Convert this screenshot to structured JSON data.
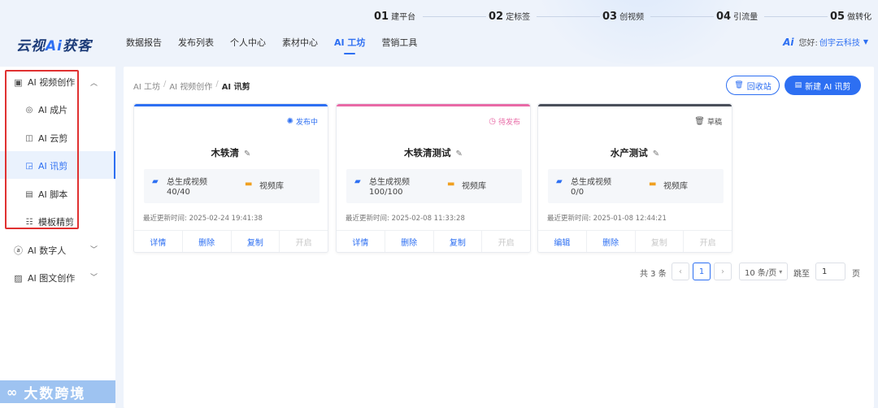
{
  "steps": [
    {
      "num": "01",
      "label": "建平台"
    },
    {
      "num": "02",
      "label": "定标签"
    },
    {
      "num": "03",
      "label": "创视频"
    },
    {
      "num": "04",
      "label": "引流量"
    },
    {
      "num": "05",
      "label": "做转化"
    }
  ],
  "logo": {
    "part1": "云视",
    "part2": "Ai",
    "part3": "获客"
  },
  "nav": [
    "数据报告",
    "发布列表",
    "个人中心",
    "素材中心",
    "AI 工坊",
    "营销工具"
  ],
  "nav_active_index": 4,
  "user": {
    "brand_icon": "Ai",
    "greeting": "您好:",
    "name": "创宇云科技"
  },
  "sidebar": {
    "group_video": "AI 视频创作",
    "items": [
      "AI 成片",
      "AI 云剪",
      "AI 讯剪",
      "AI 脚本",
      "模板精剪"
    ],
    "active_item_index": 2,
    "group_digital": "AI 数字人",
    "group_imgtext": "AI 图文创作"
  },
  "watermark": "大数跨境",
  "breadcrumb": {
    "l1": "AI 工坊",
    "l2": "AI 视频创作",
    "l3": "AI 讯剪",
    "sep": "/"
  },
  "buttons": {
    "recycle": "回收站",
    "new": "新建 AI 讯剪"
  },
  "labels": {
    "total": "总生成视频",
    "library": "视频库",
    "updated_prefix": "最近更新时间:"
  },
  "cards": [
    {
      "status": "发布中",
      "status_icon": "loading-icon",
      "status_color": "#2d6ff2",
      "bar_color": "#2d6ff2",
      "title": "木轶清",
      "count": "40/40",
      "updated": "2025-02-24 19:41:38",
      "actions": [
        {
          "label": "详情",
          "enabled": true
        },
        {
          "label": "删除",
          "enabled": true
        },
        {
          "label": "复制",
          "enabled": true
        },
        {
          "label": "开启",
          "enabled": false
        }
      ]
    },
    {
      "status": "待发布",
      "status_icon": "clock-icon",
      "status_color": "#e86aa6",
      "bar_color": "#e86aa6",
      "title": "木轶清测试",
      "count": "100/100",
      "updated": "2025-02-08 11:33:28",
      "actions": [
        {
          "label": "详情",
          "enabled": true
        },
        {
          "label": "删除",
          "enabled": true
        },
        {
          "label": "复制",
          "enabled": true
        },
        {
          "label": "开启",
          "enabled": false
        }
      ]
    },
    {
      "status": "草稿",
      "status_icon": "trash-icon",
      "status_color": "#555555",
      "bar_color": "#4a4f5a",
      "title": "水产测试",
      "count": "0/0",
      "updated": "2025-01-08 12:44:21",
      "actions": [
        {
          "label": "编辑",
          "enabled": true
        },
        {
          "label": "删除",
          "enabled": true
        },
        {
          "label": "复制",
          "enabled": false
        },
        {
          "label": "开启",
          "enabled": false
        }
      ]
    }
  ],
  "pagination": {
    "total": "共 3 条",
    "prev": "‹",
    "page": "1",
    "next": "›",
    "page_size": "10 条/页",
    "jump": "跳至",
    "jump_value": "1",
    "unit": "页"
  },
  "colors": {
    "accent": "#2d6ff2",
    "highlight_box": "#e03131"
  }
}
